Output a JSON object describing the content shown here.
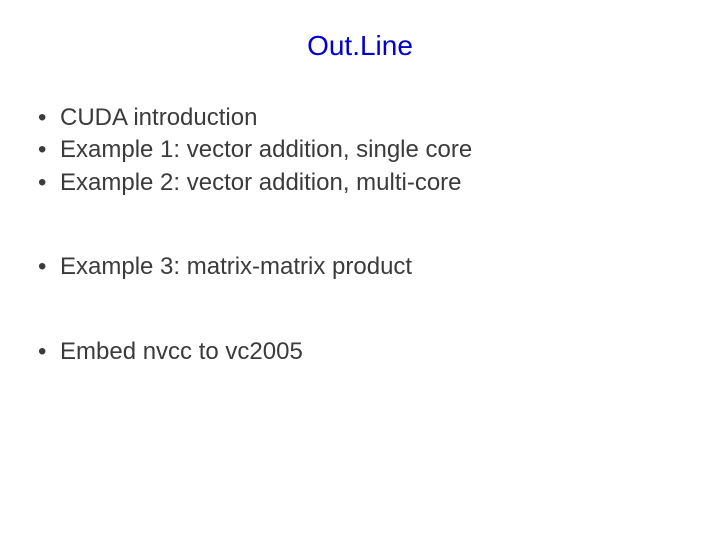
{
  "title": "Out.Line",
  "items": [
    "CUDA introduction",
    "Example 1: vector addition, single core",
    "Example 2: vector addition, multi-core",
    "Example 3: matrix-matrix product",
    "Embed nvcc to vc2005"
  ]
}
